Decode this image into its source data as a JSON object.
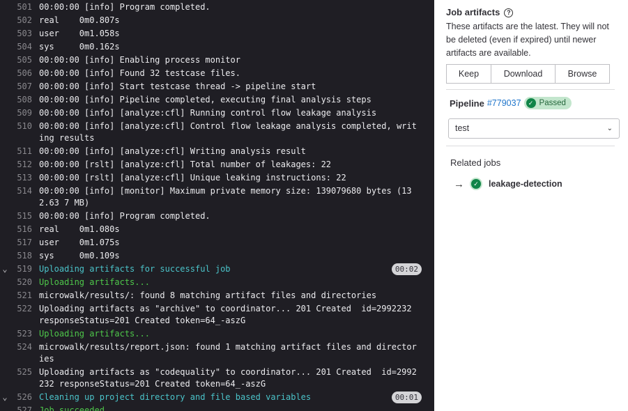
{
  "log": {
    "lines": [
      {
        "n": "501",
        "t": "00:00:00 [info] Program completed."
      },
      {
        "n": "502",
        "t": "real    0m0.807s"
      },
      {
        "n": "503",
        "t": "user    0m1.058s"
      },
      {
        "n": "504",
        "t": "sys     0m0.162s"
      },
      {
        "n": "505",
        "t": "00:00:00 [info] Enabling process monitor"
      },
      {
        "n": "506",
        "t": "00:00:00 [info] Found 32 testcase files."
      },
      {
        "n": "507",
        "t": "00:00:00 [info] Start testcase thread -> pipeline start"
      },
      {
        "n": "508",
        "t": "00:00:00 [info] Pipeline completed, executing final analysis steps"
      },
      {
        "n": "509",
        "t": "00:00:00 [info] [analyze:cfl] Running control flow leakage analysis"
      },
      {
        "n": "510",
        "t": "00:00:00 [info] [analyze:cfl] Control flow leakage analysis completed, writing results"
      },
      {
        "n": "511",
        "t": "00:00:00 [info] [analyze:cfl] Writing analysis result"
      },
      {
        "n": "512",
        "t": "00:00:00 [rslt] [analyze:cfl] Total number of leakages: 22"
      },
      {
        "n": "513",
        "t": "00:00:00 [rslt] [analyze:cfl] Unique leaking instructions: 22"
      },
      {
        "n": "514",
        "t": "00:00:00 [info] [monitor] Maximum private memory size: 139079680 bytes (132.63 7 MB)"
      },
      {
        "n": "515",
        "t": "00:00:00 [info] Program completed."
      },
      {
        "n": "516",
        "t": "real    0m1.080s"
      },
      {
        "n": "517",
        "t": "user    0m1.075s"
      },
      {
        "n": "518",
        "t": "sys     0m0.109s"
      },
      {
        "n": "519",
        "t": "Uploading artifacts for successful job",
        "color": "cyan",
        "chevron": true,
        "dur": "00:02"
      },
      {
        "n": "520",
        "t": "Uploading artifacts...",
        "color": "green"
      },
      {
        "n": "521",
        "t": "microwalk/results/: found 8 matching artifact files and directories"
      },
      {
        "n": "522",
        "t": "Uploading artifacts as \"archive\" to coordinator... 201 Created  id=2992232 responseStatus=201 Created token=64_-aszG"
      },
      {
        "n": "523",
        "t": "Uploading artifacts...",
        "color": "green"
      },
      {
        "n": "524",
        "t": "microwalk/results/report.json: found 1 matching artifact files and directories"
      },
      {
        "n": "525",
        "t": "Uploading artifacts as \"codequality\" to coordinator... 201 Created  id=2992232 responseStatus=201 Created token=64_-aszG"
      },
      {
        "n": "526",
        "t": "Cleaning up project directory and file based variables",
        "color": "cyan",
        "chevron": true,
        "dur": "00:01"
      },
      {
        "n": "527",
        "t": "Job succeeded",
        "color": "green"
      }
    ]
  },
  "artifacts": {
    "title": "Job artifacts",
    "description": "These artifacts are the latest. They will not be deleted (even if expired) until newer artifacts are available.",
    "buttons": {
      "keep": "Keep",
      "download": "Download",
      "browse": "Browse"
    }
  },
  "pipeline": {
    "label": "Pipeline",
    "id": "#779037",
    "status": "Passed",
    "stage": "test"
  },
  "related": {
    "title": "Related jobs",
    "job": "leakage-detection"
  },
  "colors": {
    "log_bg": "#1f1e24",
    "cyan": "#4bc3c9",
    "green": "#4ec74a",
    "success": "#108548",
    "link": "#1f75cb"
  }
}
